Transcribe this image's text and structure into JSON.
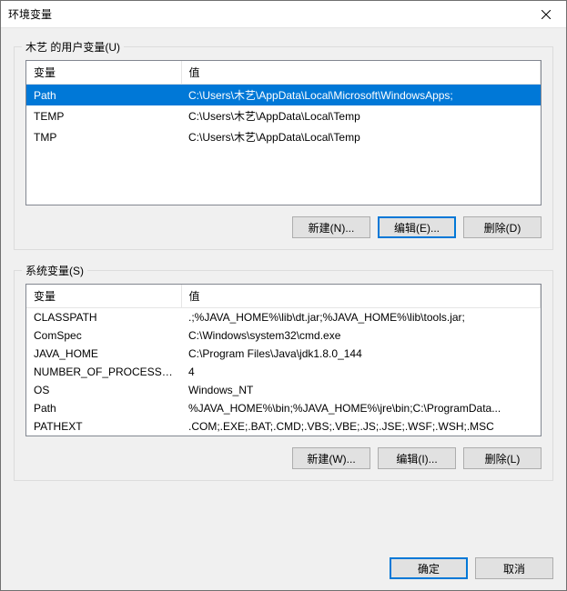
{
  "window": {
    "title": "环境变量"
  },
  "user_section": {
    "label": "木艺 的用户变量(U)",
    "columns": {
      "name": "变量",
      "value": "值"
    },
    "rows": [
      {
        "name": "Path",
        "value": "C:\\Users\\木艺\\AppData\\Local\\Microsoft\\WindowsApps;",
        "selected": true
      },
      {
        "name": "TEMP",
        "value": "C:\\Users\\木艺\\AppData\\Local\\Temp",
        "selected": false
      },
      {
        "name": "TMP",
        "value": "C:\\Users\\木艺\\AppData\\Local\\Temp",
        "selected": false
      }
    ],
    "buttons": {
      "new": "新建(N)...",
      "edit": "编辑(E)...",
      "delete": "删除(D)"
    }
  },
  "system_section": {
    "label": "系统变量(S)",
    "columns": {
      "name": "变量",
      "value": "值"
    },
    "rows": [
      {
        "name": "CLASSPATH",
        "value": ".;%JAVA_HOME%\\lib\\dt.jar;%JAVA_HOME%\\lib\\tools.jar;"
      },
      {
        "name": "ComSpec",
        "value": "C:\\Windows\\system32\\cmd.exe"
      },
      {
        "name": "JAVA_HOME",
        "value": "C:\\Program Files\\Java\\jdk1.8.0_144"
      },
      {
        "name": "NUMBER_OF_PROCESSORS",
        "value": "4"
      },
      {
        "name": "OS",
        "value": "Windows_NT"
      },
      {
        "name": "Path",
        "value": "%JAVA_HOME%\\bin;%JAVA_HOME%\\jre\\bin;C:\\ProgramData..."
      },
      {
        "name": "PATHEXT",
        "value": ".COM;.EXE;.BAT;.CMD;.VBS;.VBE;.JS;.JSE;.WSF;.WSH;.MSC"
      }
    ],
    "buttons": {
      "new": "新建(W)...",
      "edit": "编辑(I)...",
      "delete": "删除(L)"
    }
  },
  "footer": {
    "ok": "确定",
    "cancel": "取消"
  },
  "col_widths": {
    "name": "170px",
    "value": "auto"
  }
}
